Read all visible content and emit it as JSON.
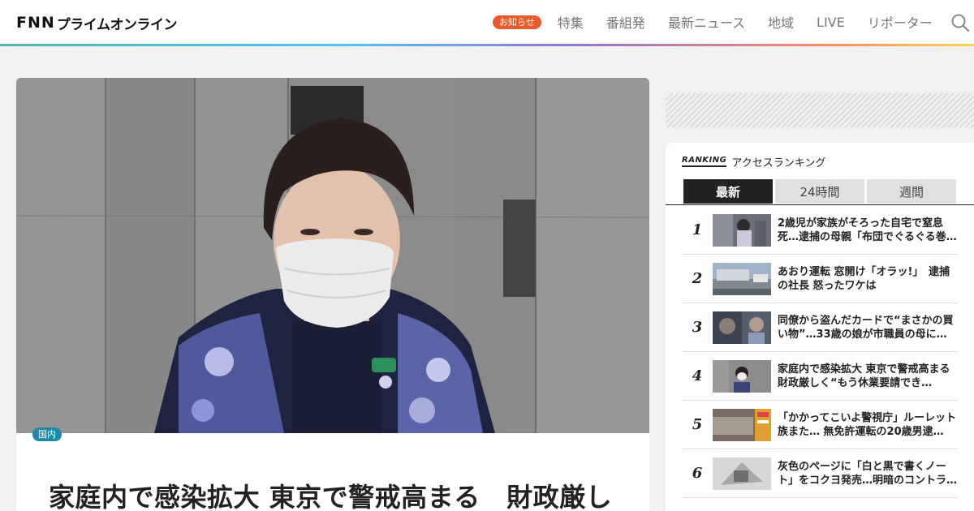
{
  "header": {
    "logo_fnn": "FNN",
    "logo_sub": "プライムオンライン",
    "notice_badge": "お知らせ",
    "nav": [
      "特集",
      "番組発",
      "最新ニュース",
      "地域",
      "LIVE",
      "リポーター"
    ]
  },
  "article": {
    "category": "国内",
    "title": "家庭内で感染拡大 東京で警戒高まる　財政厳し"
  },
  "ranking": {
    "logo": "RANKING",
    "title": "アクセスランキング",
    "tabs": [
      "最新",
      "24時間",
      "週間"
    ],
    "active_tab": "最新",
    "items": [
      {
        "rank": "1",
        "text": "2歳児が家族がそろった自宅で窒息死…逮捕の母親「布団でぐるぐる巻…"
      },
      {
        "rank": "2",
        "text": "あおり運転 窓開け「オラッ!」　逮捕の社長 怒ったワケは"
      },
      {
        "rank": "3",
        "text": "同僚から盗んだカードで“まさかの買い物”…33歳の娘が市職員の母に…"
      },
      {
        "rank": "4",
        "text": "家庭内で感染拡大 東京で警戒高まる　財政厳しく“もう休業要請でき…"
      },
      {
        "rank": "5",
        "text": "「かかってこいよ警視庁」ルーレット族また… 無免許運転の20歳男逮…"
      },
      {
        "rank": "6",
        "text": "灰色のページに「白と黒で書くノート」をコクヨ発売…明暗のコントラ…"
      }
    ]
  },
  "colors": {
    "notice": "#e85b2b",
    "category": "#1f8aa8",
    "tab_active": "#222222"
  }
}
